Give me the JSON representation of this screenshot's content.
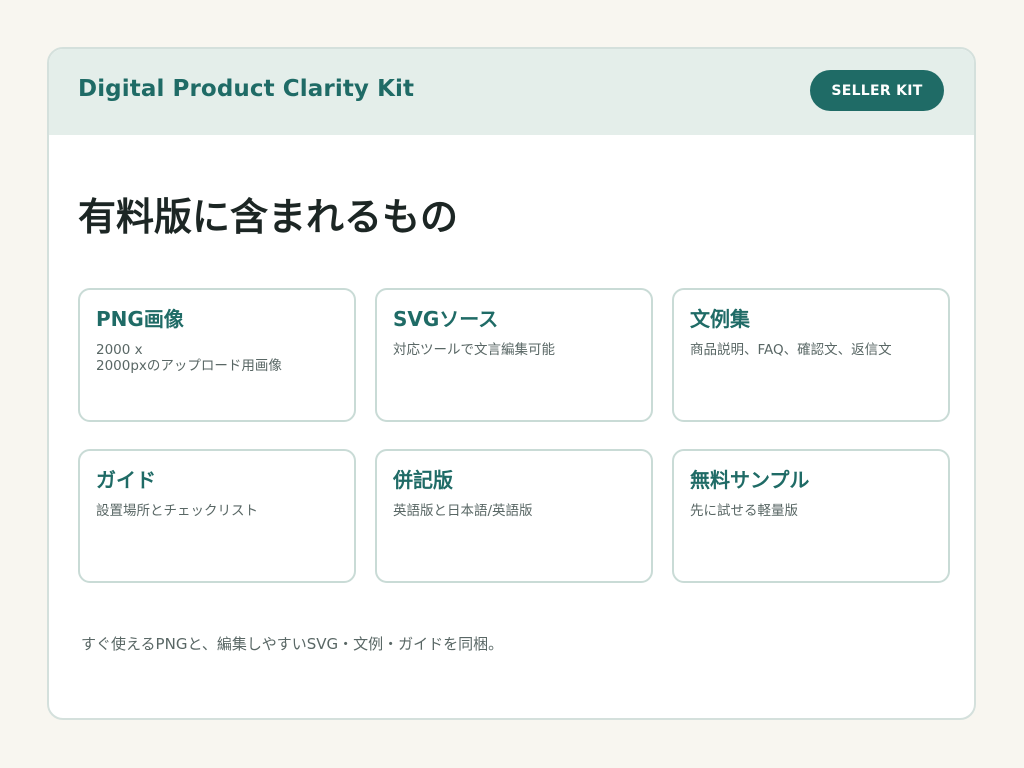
{
  "header": {
    "brand": "Digital Product Clarity Kit",
    "badge_label": "SELLER KIT"
  },
  "main": {
    "heading": "有料版に含まれるもの",
    "features": [
      {
        "title": "PNG画像",
        "description": "2000 x\n2000pxのアップロード用画像"
      },
      {
        "title": "SVGソース",
        "description": "対応ツールで文言編集可能"
      },
      {
        "title": "文例集",
        "description": "商品説明、FAQ、確認文、返信文"
      },
      {
        "title": "ガイド",
        "description": "設置場所とチェックリスト"
      },
      {
        "title": "併記版",
        "description": "英語版と日本語/英語版"
      },
      {
        "title": "無料サンプル",
        "description": "先に試せる軽量版"
      }
    ],
    "footer_note": "すぐ使えるPNGと、編集しやすいSVG・文例・ガイドを同梱。"
  },
  "colors": {
    "accent": "#1f6b66",
    "header_bg": "#e4eeea",
    "page_bg": "#f8f6f0",
    "card_border": "#c9dbd6"
  }
}
